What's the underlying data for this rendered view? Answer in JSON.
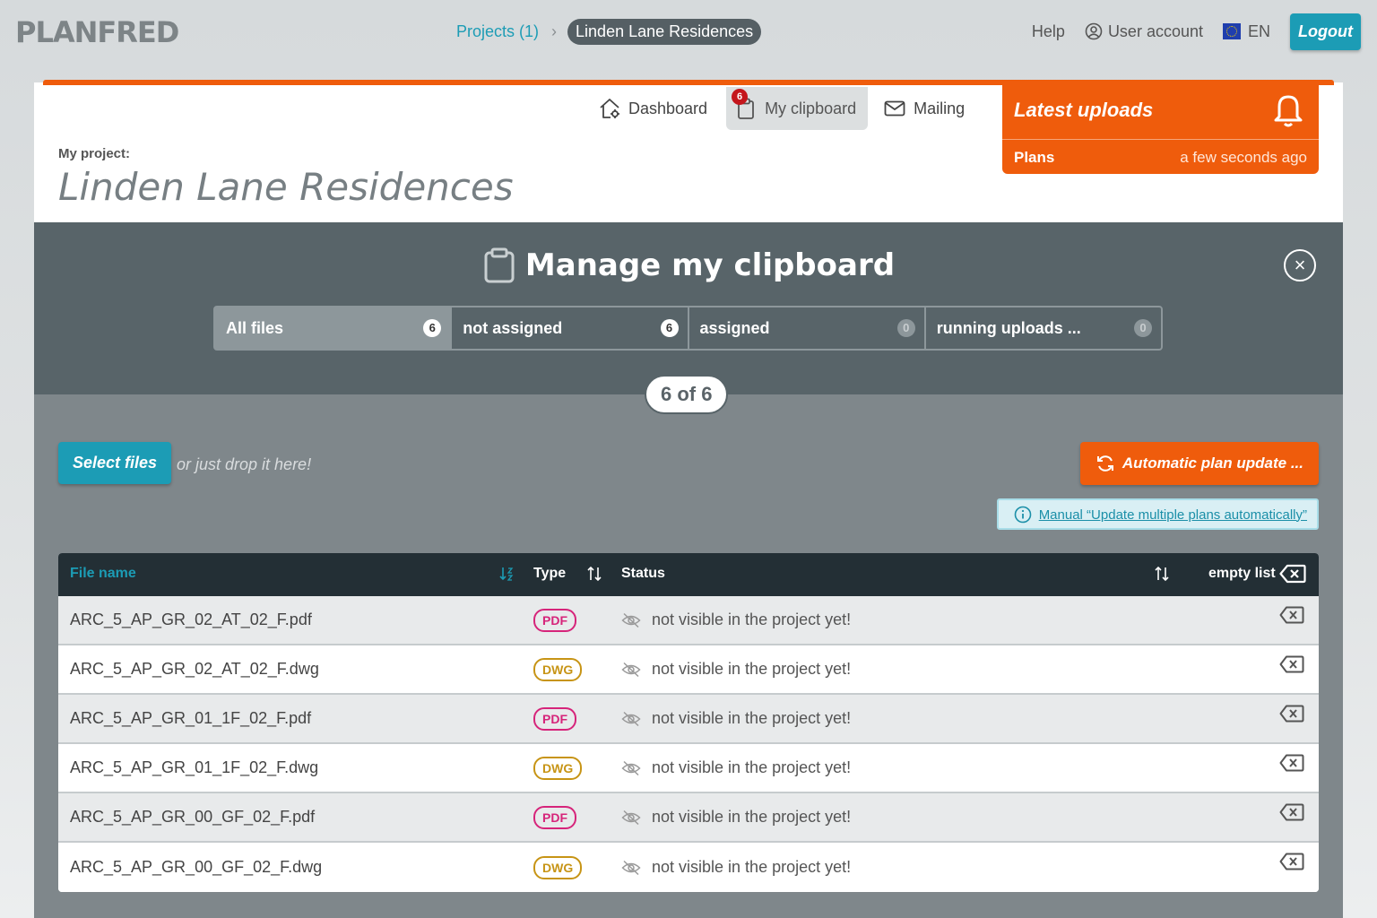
{
  "brand": {
    "logo": "PLANFRED"
  },
  "breadcrumb": {
    "projects": "Projects (1)",
    "separator": "›",
    "current": "Linden Lane Residences"
  },
  "topnav": {
    "help": "Help",
    "user_account": "User account",
    "language": "EN",
    "logout": "Logout"
  },
  "project": {
    "label": "My project:",
    "title": "Linden Lane Residences"
  },
  "tabs": [
    {
      "label": "Dashboard",
      "icon": "home-gear-icon"
    },
    {
      "label": "My clipboard",
      "icon": "clipboard-icon",
      "badge": "6"
    },
    {
      "label": "Mailing",
      "icon": "envelope-icon"
    }
  ],
  "latest_uploads": {
    "title": "Latest uploads",
    "item": "Plans",
    "time": "a few seconds ago"
  },
  "clipboard": {
    "title": "Manage my clipboard",
    "close": "×",
    "filters": [
      {
        "label": "All files",
        "count": "6"
      },
      {
        "label": "not assigned",
        "count": "6"
      },
      {
        "label": "assigned",
        "count": "0"
      },
      {
        "label": "running uploads ...",
        "count": "0"
      }
    ],
    "counter": "6 of 6"
  },
  "actions": {
    "select_files": "Select files",
    "drop_hint": "or just drop it here!",
    "auto_update": "Automatic plan update ...",
    "manual_link": "Manual “Update multiple plans automatically”"
  },
  "table": {
    "headers": {
      "file_name": "File name",
      "type": "Type",
      "status": "Status",
      "empty_list": "empty list"
    },
    "rows": [
      {
        "file": "ARC_5_AP_GR_02_AT_02_F.pdf",
        "type": "PDF",
        "status": "not visible in the project yet!"
      },
      {
        "file": "ARC_5_AP_GR_02_AT_02_F.dwg",
        "type": "DWG",
        "status": "not visible in the project yet!"
      },
      {
        "file": "ARC_5_AP_GR_01_1F_02_F.pdf",
        "type": "PDF",
        "status": "not visible in the project yet!"
      },
      {
        "file": "ARC_5_AP_GR_01_1F_02_F.dwg",
        "type": "DWG",
        "status": "not visible in the project yet!"
      },
      {
        "file": "ARC_5_AP_GR_00_GF_02_F.pdf",
        "type": "PDF",
        "status": "not visible in the project yet!"
      },
      {
        "file": "ARC_5_AP_GR_00_GF_02_F.dwg",
        "type": "DWG",
        "status": "not visible in the project yet!"
      }
    ]
  },
  "colors": {
    "accent_teal": "#1c9cb5",
    "accent_orange": "#ef5c0c",
    "panel_dark": "#586469",
    "header_dark": "#232f35",
    "pdf": "#d6247a",
    "dwg": "#c79415"
  }
}
